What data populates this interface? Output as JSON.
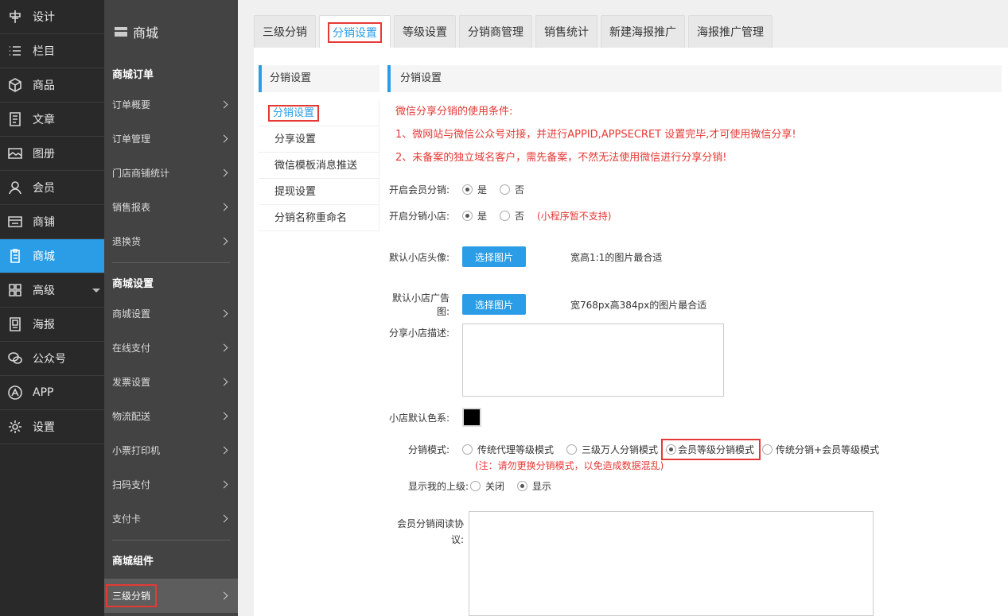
{
  "nav1": {
    "items": [
      {
        "label": "设计",
        "icon": "design-icon"
      },
      {
        "label": "栏目",
        "icon": "list-icon"
      },
      {
        "label": "商品",
        "icon": "box-icon"
      },
      {
        "label": "文章",
        "icon": "article-icon"
      },
      {
        "label": "图册",
        "icon": "image-icon"
      },
      {
        "label": "会员",
        "icon": "user-icon"
      },
      {
        "label": "商铺",
        "icon": "store-icon"
      },
      {
        "label": "商城",
        "icon": "clipboard-icon"
      },
      {
        "label": "高级",
        "icon": "grid-icon"
      },
      {
        "label": "海报",
        "icon": "poster-icon"
      },
      {
        "label": "公众号",
        "icon": "wechat-icon"
      },
      {
        "label": "APP",
        "icon": "app-icon"
      },
      {
        "label": "设置",
        "icon": "gear-icon"
      }
    ]
  },
  "nav2": {
    "title": "商城",
    "sections": [
      {
        "title": "商城订单",
        "items": [
          "订单概要",
          "订单管理",
          "门店商铺统计",
          "销售报表",
          "退换货"
        ]
      },
      {
        "title": "商城设置",
        "items": [
          "商城设置",
          "在线支付",
          "发票设置",
          "物流配送",
          "小票打印机",
          "扫码支付",
          "支付卡"
        ]
      },
      {
        "title": "商城组件",
        "items": [
          "三级分销"
        ]
      }
    ]
  },
  "tabs": [
    "三级分销",
    "分销设置",
    "等级设置",
    "分销商管理",
    "销售统计",
    "新建海报推广",
    "海报推广管理"
  ],
  "sub": {
    "title": "分销设置",
    "items": [
      "分销设置",
      "分享设置",
      "微信模板消息推送",
      "提现设置",
      "分销名称重命名"
    ]
  },
  "content": {
    "title": "分销设置",
    "notices": [
      "微信分享分销的使用条件:",
      "1、微网站与微信公众号对接，并进行APPID,APPSECRET 设置完毕,才可使用微信分享!",
      "2、未备案的独立域名客户，需先备案，不然无法使用微信进行分享分销!"
    ],
    "member_dist": {
      "label": "开启会员分销:",
      "yes": "是",
      "no": "否"
    },
    "shop_dist": {
      "label": "开启分销小店:",
      "yes": "是",
      "no": "否",
      "hint": "(小程序暂不支持)"
    },
    "avatar": {
      "label": "默认小店头像:",
      "button": "选择图片",
      "tip": "宽高1:1的图片最合适"
    },
    "banner": {
      "label": "默认小店广告图:",
      "button": "选择图片",
      "tip": "宽768px高384px的图片最合适"
    },
    "desc": {
      "label": "分享小店描述:"
    },
    "color": {
      "label": "小店默认色系:",
      "value": "#000000"
    },
    "mode": {
      "label": "分销模式:",
      "options": [
        "传统代理等级模式",
        "三级万人分销模式",
        "会员等级分销模式",
        "传统分销+会员等级模式"
      ],
      "note": "(注：请勿更换分销模式，以免造成数据混乱)"
    },
    "show_parent": {
      "label": "显示我的上级:",
      "off": "关闭",
      "on": "显示"
    },
    "agreement": {
      "label_line1": "会员分销阅读协",
      "label_line2": "议:"
    }
  }
}
